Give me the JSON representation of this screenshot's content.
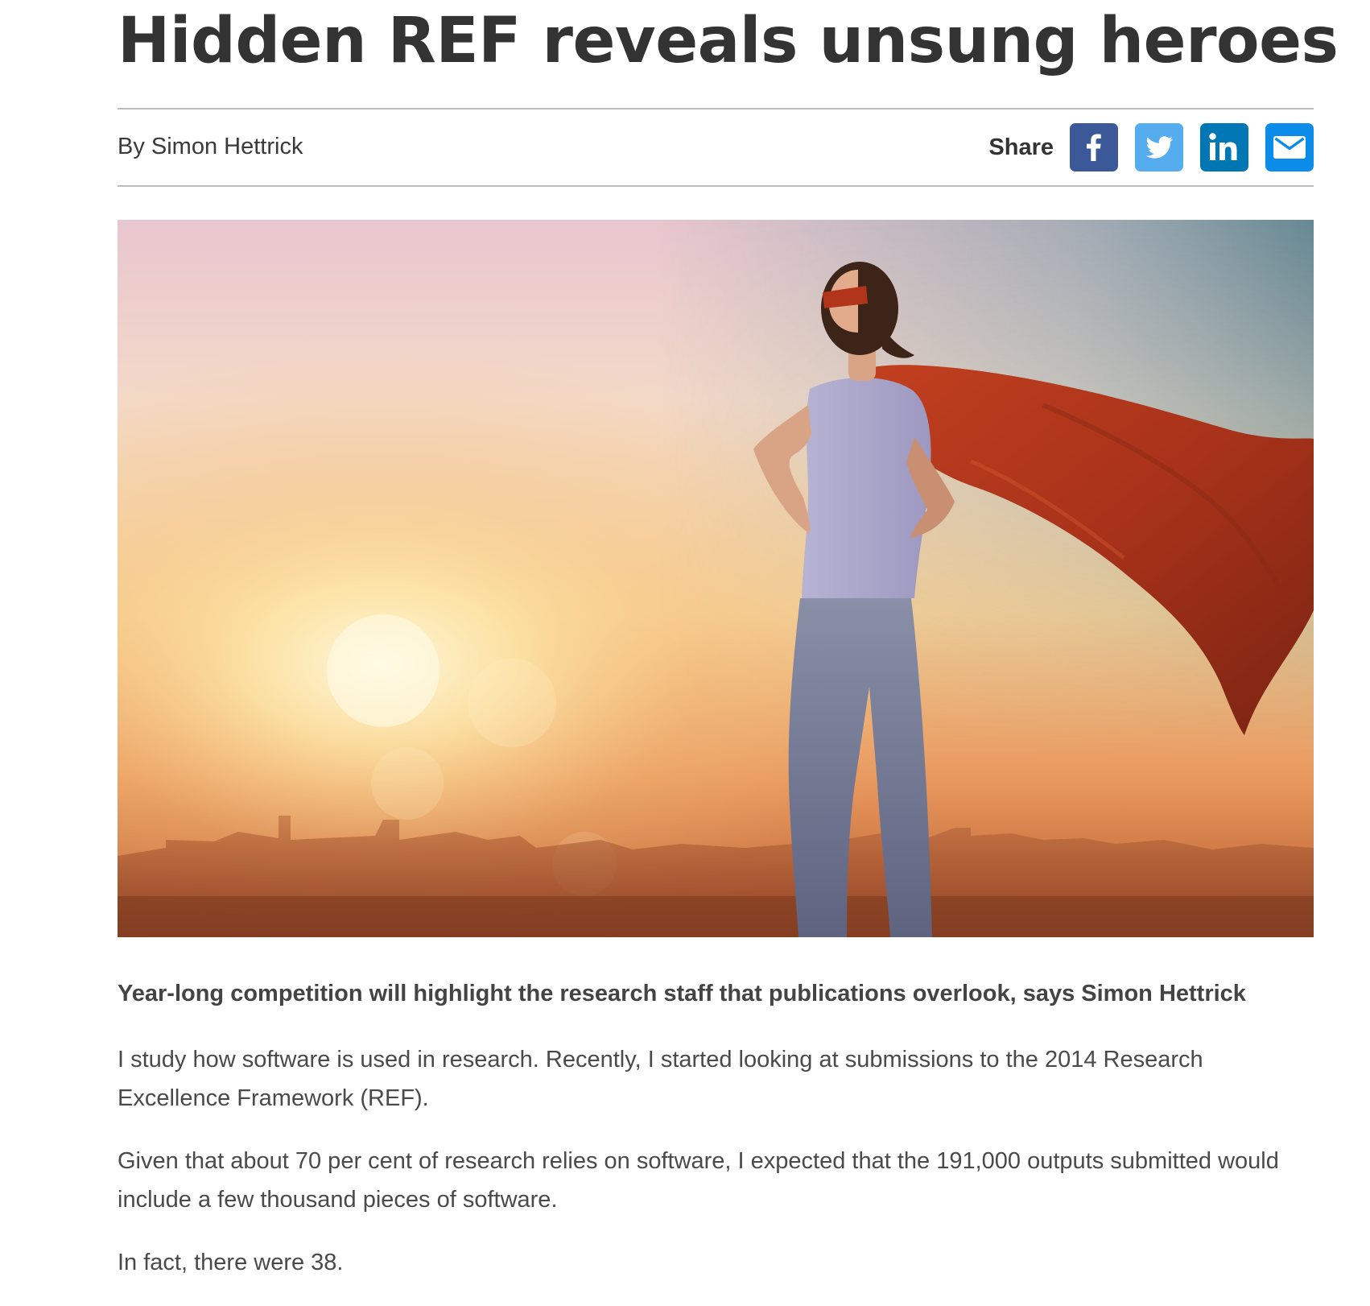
{
  "article": {
    "headline": "Hidden REF reveals unsung heroes",
    "byline": "By Simon Hettrick",
    "standfirst": "Year-long competition will highlight the research staff that publications overlook, says Simon Hettrick",
    "paragraphs": [
      "I study how software is used in research. Recently, I started looking at submissions to the 2014 Research Excellence Framework (REF).",
      "Given that about 70 per cent of research relies on software, I expected that the 191,000 outputs submitted would include a few thousand pieces of software.",
      "In fact, there were 38."
    ]
  },
  "share": {
    "label": "Share",
    "buttons": [
      {
        "icon": "facebook-icon",
        "color": "#3b5998"
      },
      {
        "icon": "twitter-icon",
        "color": "#55acee"
      },
      {
        "icon": "linkedin-icon",
        "color": "#0077b5"
      },
      {
        "icon": "email-icon",
        "color": "#0a8ce8"
      }
    ]
  },
  "hero_image": {
    "icon": "superhero-woman-sunset-photo"
  }
}
